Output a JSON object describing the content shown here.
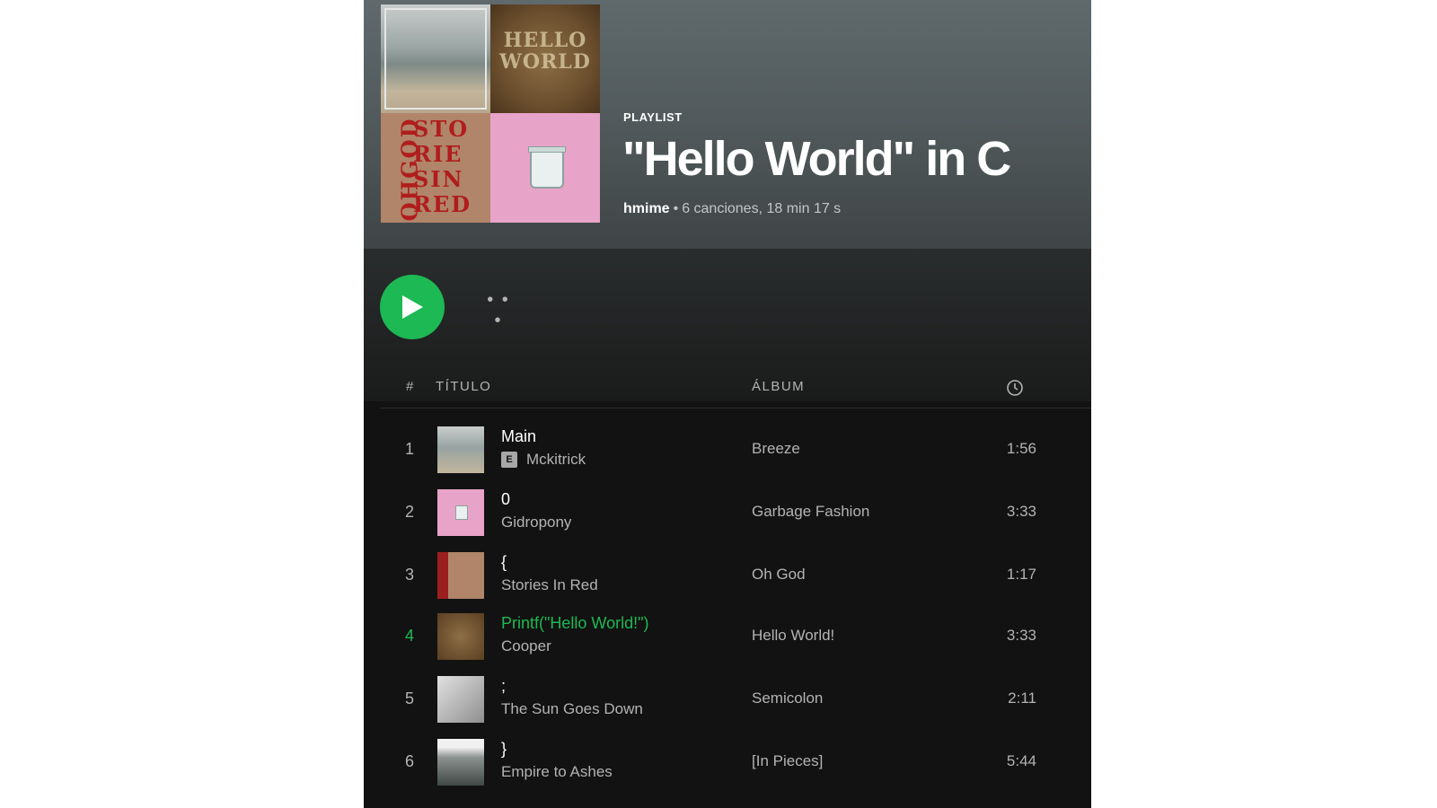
{
  "header": {
    "type_label": "PLAYLIST",
    "title": "\"Hello World\" in C",
    "owner": "hmime",
    "stats": "6 canciones, 18 min 17 s"
  },
  "cover_mosaic": {
    "tile2_text": "HELLO WORLD",
    "tile3_text": "STO RIE SIN RED",
    "tile3_side_text": "OHGOD"
  },
  "controls": {
    "play_icon": "play-icon",
    "more_label": "• • •"
  },
  "columns": {
    "number": "#",
    "title": "TÍTULO",
    "album": "ÁLBUM",
    "duration_icon": "clock-icon"
  },
  "tracks": [
    {
      "number": "1",
      "title": "Main",
      "artist": "Mckitrick",
      "explicit": "E",
      "album": "Breeze",
      "duration": "1:56"
    },
    {
      "number": "2",
      "title": "0",
      "artist": "Gidropony",
      "album": "Garbage Fashion",
      "duration": "3:33"
    },
    {
      "number": "3",
      "title": "{",
      "artist": "Stories In Red",
      "album": "Oh God",
      "duration": "1:17"
    },
    {
      "number": "4",
      "title": "Printf(\"Hello World!\")",
      "artist": "Cooper",
      "album": "Hello World!",
      "duration": "3:33",
      "playing": true
    },
    {
      "number": "5",
      "title": ";",
      "artist": "The Sun Goes Down",
      "album": "Semicolon",
      "duration": "2:11"
    },
    {
      "number": "6",
      "title": "}",
      "artist": "Empire to Ashes",
      "album": "[In Pieces]",
      "duration": "5:44"
    }
  ],
  "colors": {
    "accent": "#1db954",
    "background": "#121212",
    "header_gradient_top": "#606a6c"
  }
}
